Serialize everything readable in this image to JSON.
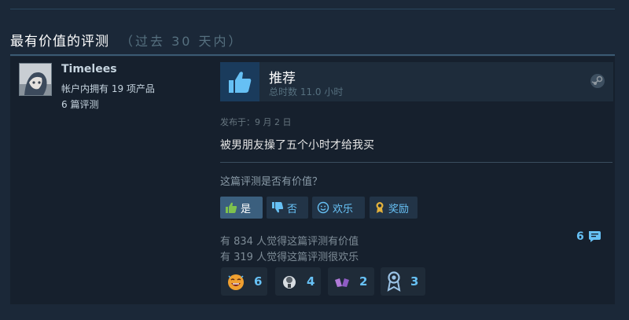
{
  "section": {
    "title": "最有价值的评测",
    "subtitle": "（过去 30 天内）"
  },
  "reviewer": {
    "name": "Timelees",
    "owned_products": "帐户内拥有 19 项产品",
    "review_count": "6 篇评测"
  },
  "review": {
    "verdict": "推荐",
    "hours": "总时数 11.0 小时",
    "posted": "发布于：9 月 2 日",
    "text": "被男朋友操了五个小时才给我买"
  },
  "helpful": {
    "question": "这篇评测是否有价值？",
    "buttons": {
      "yes": "是",
      "no": "否",
      "funny": "欢乐",
      "award": "奖励"
    },
    "helpful_stat": "有 834 人觉得这篇评测有价值",
    "funny_stat": "有 319 人觉得这篇评测很欢乐",
    "comment_count": "6"
  },
  "awards": [
    {
      "icon": "laughing-face-icon",
      "count": "6"
    },
    {
      "icon": "mind-blown-icon",
      "count": "4"
    },
    {
      "icon": "clapping-hands-icon",
      "count": "2"
    },
    {
      "icon": "ribbon-medal-icon",
      "count": "3"
    }
  ],
  "colors": {
    "background": "#1b2838",
    "card": "#16202d",
    "accent": "#67c1f5",
    "selected_button": "#3b5f7e"
  }
}
